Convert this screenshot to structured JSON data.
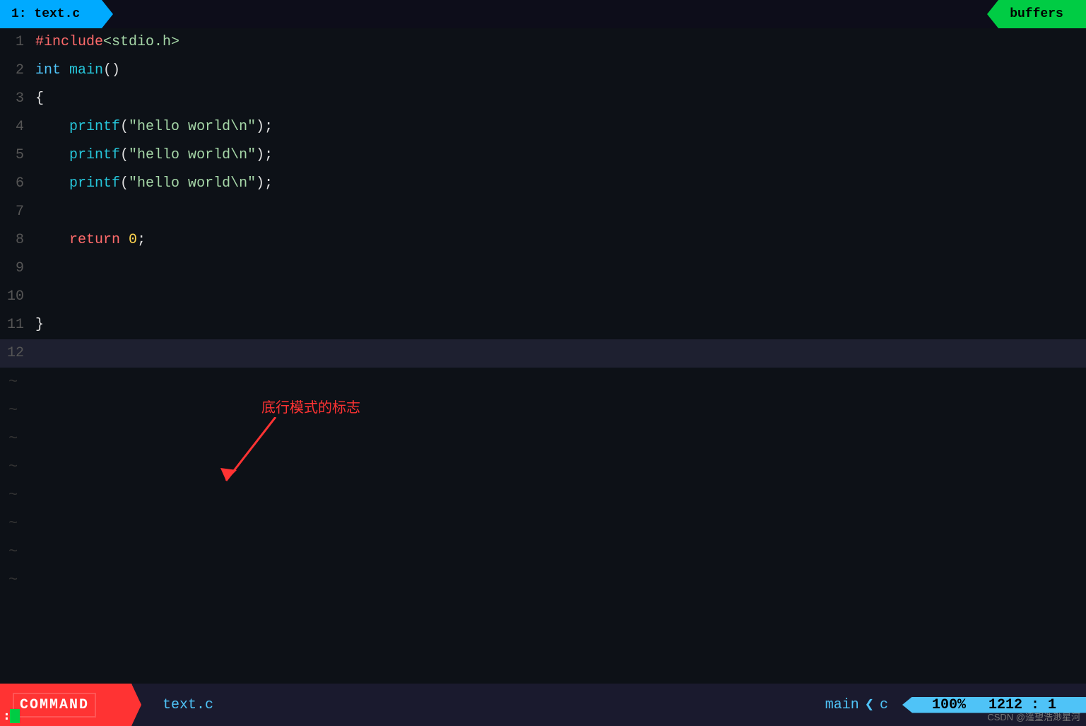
{
  "tab": {
    "active_label": "1: text.c",
    "buffers_label": "buffers"
  },
  "editor": {
    "lines": [
      {
        "num": "1",
        "content": "#include<stdio.h>",
        "type": "include"
      },
      {
        "num": "2",
        "content": "int main()",
        "type": "func_decl"
      },
      {
        "num": "3",
        "content": "{",
        "type": "punct"
      },
      {
        "num": "4",
        "content": "    printf(\"hello world\\n\");",
        "type": "printf"
      },
      {
        "num": "5",
        "content": "    printf(\"hello world\\n\");",
        "type": "printf"
      },
      {
        "num": "6",
        "content": "    printf(\"hello world\\n\");",
        "type": "printf"
      },
      {
        "num": "7",
        "content": "",
        "type": "empty"
      },
      {
        "num": "8",
        "content": "    return 0;",
        "type": "return"
      },
      {
        "num": "9",
        "content": "",
        "type": "empty"
      },
      {
        "num": "10",
        "content": "",
        "type": "empty"
      },
      {
        "num": "11",
        "content": "}",
        "type": "punct"
      },
      {
        "num": "12",
        "content": "",
        "type": "highlighted"
      }
    ],
    "tildes": [
      "~",
      "~",
      "~",
      "~",
      "~",
      "~",
      "~",
      "~"
    ]
  },
  "annotation": {
    "text": "底行模式的标志"
  },
  "status": {
    "mode": "COMMAND",
    "filename": "text.c",
    "func_name": "main",
    "lang": "c",
    "percent": "100%",
    "line": "1212",
    "col": "1"
  },
  "watermark": "CSDN @遥望浩渺星河"
}
